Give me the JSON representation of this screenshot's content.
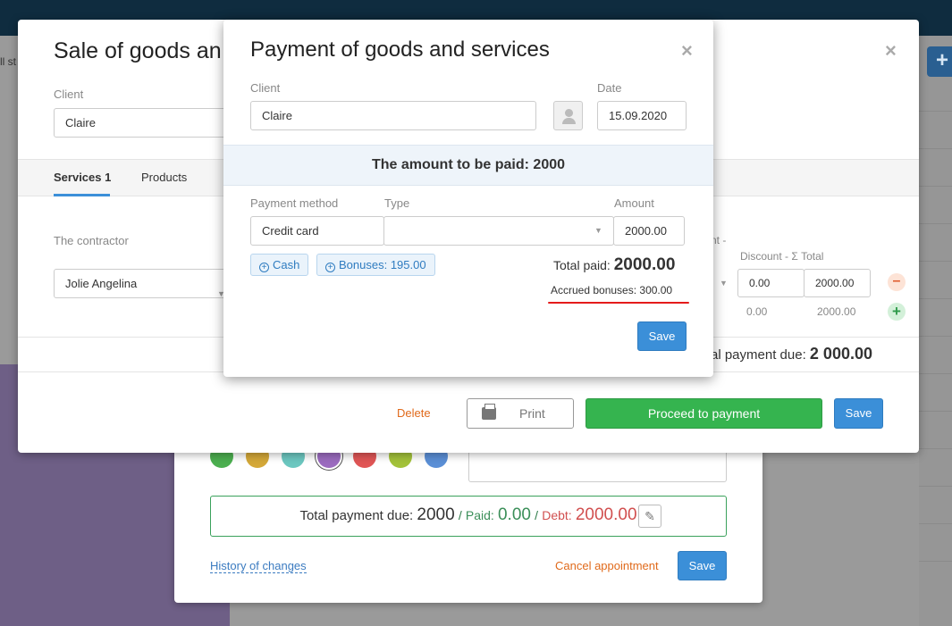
{
  "background": {
    "partial_text": "ll st"
  },
  "sale_modal": {
    "title": "Sale of goods an",
    "client_label": "Client",
    "client_value": "Claire",
    "tabs": [
      {
        "label": "Services 1",
        "active": true
      },
      {
        "label": "Products",
        "active": false
      }
    ],
    "contractor_label": "The contractor",
    "contractor_value": "Jolie Angelina",
    "header_partial": "nt -",
    "header_discount_total": "Discount - Σ Total",
    "row1": {
      "discount": "0.00",
      "total": "2000.00"
    },
    "row2": {
      "discount": "0.00",
      "total": "2000.00"
    },
    "total_due_label": "al payment due:",
    "total_due_value": "2 000.00",
    "delete_label": "Delete",
    "print_label": "Print",
    "proceed_label": "Proceed to payment",
    "save_label": "Save"
  },
  "payment_modal": {
    "title": "Payment of goods and services",
    "client_label": "Client",
    "client_value": "Claire",
    "date_label": "Date",
    "date_value": "15.09.2020",
    "amount_to_pay": "The amount to be paid: 2000",
    "payment_method_label": "Payment method",
    "type_label": "Type",
    "amount_label": "Amount",
    "payment_method_value": "Credit card",
    "type_value": "",
    "amount_value": "2000.00",
    "cash_label": "Cash",
    "bonuses_label": "Bonuses: 195.00",
    "total_paid_label": "Total paid:",
    "total_paid_value": "2000.00",
    "accrued_bonuses": "Accrued bonuses: 300.00",
    "save_label": "Save",
    "highlight_color": "#e41b1b"
  },
  "appointment": {
    "colors": [
      "#4caf50",
      "#d4a838",
      "#6cc7c0",
      "#9b6bbf",
      "#e05555",
      "#a3c23a",
      "#5b8fd6"
    ],
    "selected_color_index": 3,
    "total_due_label": "Total payment due:",
    "total_due_value": "2000",
    "paid_label": "Paid:",
    "paid_value": "0.00",
    "debt_label": "Debt:",
    "debt_value": "2000.00",
    "history_label": "History of changes",
    "cancel_label": "Cancel appointment",
    "save_label": "Save"
  }
}
